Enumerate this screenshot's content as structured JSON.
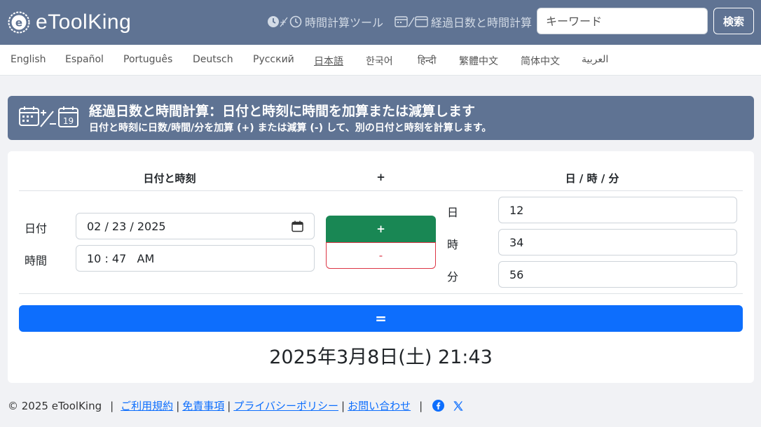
{
  "header": {
    "brand": "eToolKing",
    "nav_tools": "時間計算ツール",
    "nav_calc": "経過日数と時間計算",
    "search_placeholder": "キーワード",
    "search_button": "検索"
  },
  "languages": [
    {
      "label": "English",
      "active": false
    },
    {
      "label": "Español",
      "active": false
    },
    {
      "label": "Português",
      "active": false
    },
    {
      "label": "Deutsch",
      "active": false
    },
    {
      "label": "Русский",
      "active": false
    },
    {
      "label": "日本語",
      "active": true
    },
    {
      "label": "한국어",
      "active": false
    },
    {
      "label": "हिन्दी",
      "active": false
    },
    {
      "label": "繁體中文",
      "active": false
    },
    {
      "label": "简体中文",
      "active": false
    },
    {
      "label": "العربية",
      "active": false
    }
  ],
  "banner": {
    "title": "経過日数と時間計算：日付と時刻に時間を加算または減算します",
    "subtitle": "日付と時刻に日数/時間/分を加算 (+) または減算 (-) して、別の日付と時刻を計算します。",
    "icon_day": "19"
  },
  "calculator": {
    "col_datetime": "日付と時刻",
    "col_op": "+",
    "col_duration": "日 / 時 / 分",
    "date_label": "日付",
    "date_value": "02 / 23 / 2025",
    "time_label": "時間",
    "time_value": "10 : 47   AM",
    "plus_label": "+",
    "minus_label": "-",
    "days_label": "日",
    "days_value": "12",
    "hours_label": "時",
    "hours_value": "34",
    "minutes_label": "分",
    "minutes_value": "56",
    "equals_label": "=",
    "result": "2025年3月8日(土) 21:43"
  },
  "footer": {
    "copyright": "© 2025 eToolKing",
    "divider": "|",
    "link_terms": "ご利用規約",
    "link_disclaimer": "免責事項",
    "link_privacy": "プライバシーポリシー",
    "link_contact": "お問い合わせ"
  },
  "colors": {
    "header_bg": "#5f7393",
    "plus_green": "#198754",
    "minus_red": "#dc3545",
    "equals_blue": "#0d6efd"
  }
}
